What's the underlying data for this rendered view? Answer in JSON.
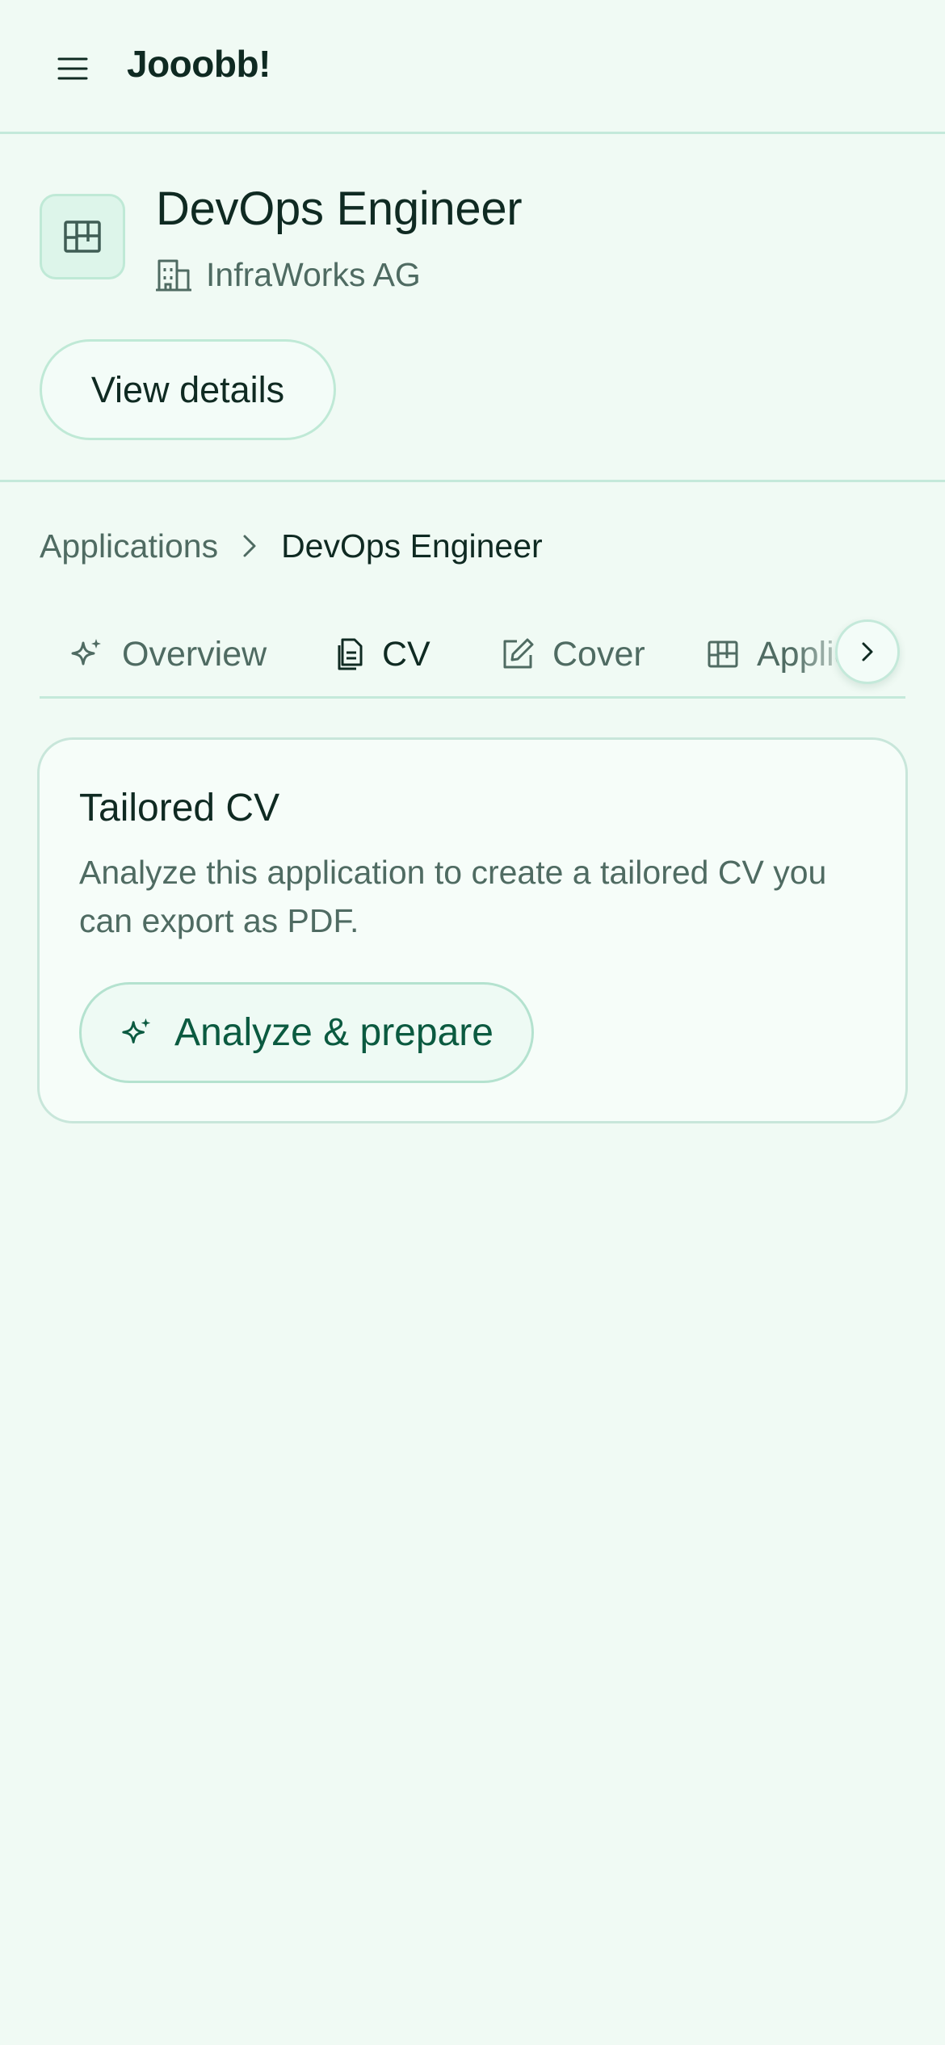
{
  "header": {
    "brand": "Jooobb!",
    "menu_icon": "hamburger-menu-icon"
  },
  "job": {
    "title": "DevOps Engineer",
    "company": "InfraWorks AG",
    "icon": "kanban-board-icon",
    "company_icon": "building-icon",
    "view_details_label": "View details"
  },
  "breadcrumb": {
    "parent": "Applications",
    "current": "DevOps Engineer",
    "separator_icon": "chevron-right-icon"
  },
  "tabs": [
    {
      "label": "Overview",
      "icon": "sparkle-icon",
      "active": false
    },
    {
      "label": "CV",
      "icon": "document-icon",
      "active": true
    },
    {
      "label": "Cover",
      "icon": "edit-square-icon",
      "active": false
    },
    {
      "label": "Application",
      "icon": "kanban-board-icon",
      "active": false
    }
  ],
  "card": {
    "title": "Tailored CV",
    "description": "Analyze this application to create a tailored CV you can export as PDF.",
    "button_label": "Analyze & prepare",
    "button_icon": "sparkle-icon"
  },
  "colors": {
    "background": "#f0faf4",
    "border": "#c4e9da",
    "text_primary": "#0f2a22",
    "text_muted": "#4f6b62",
    "accent": "#0b5a40"
  }
}
